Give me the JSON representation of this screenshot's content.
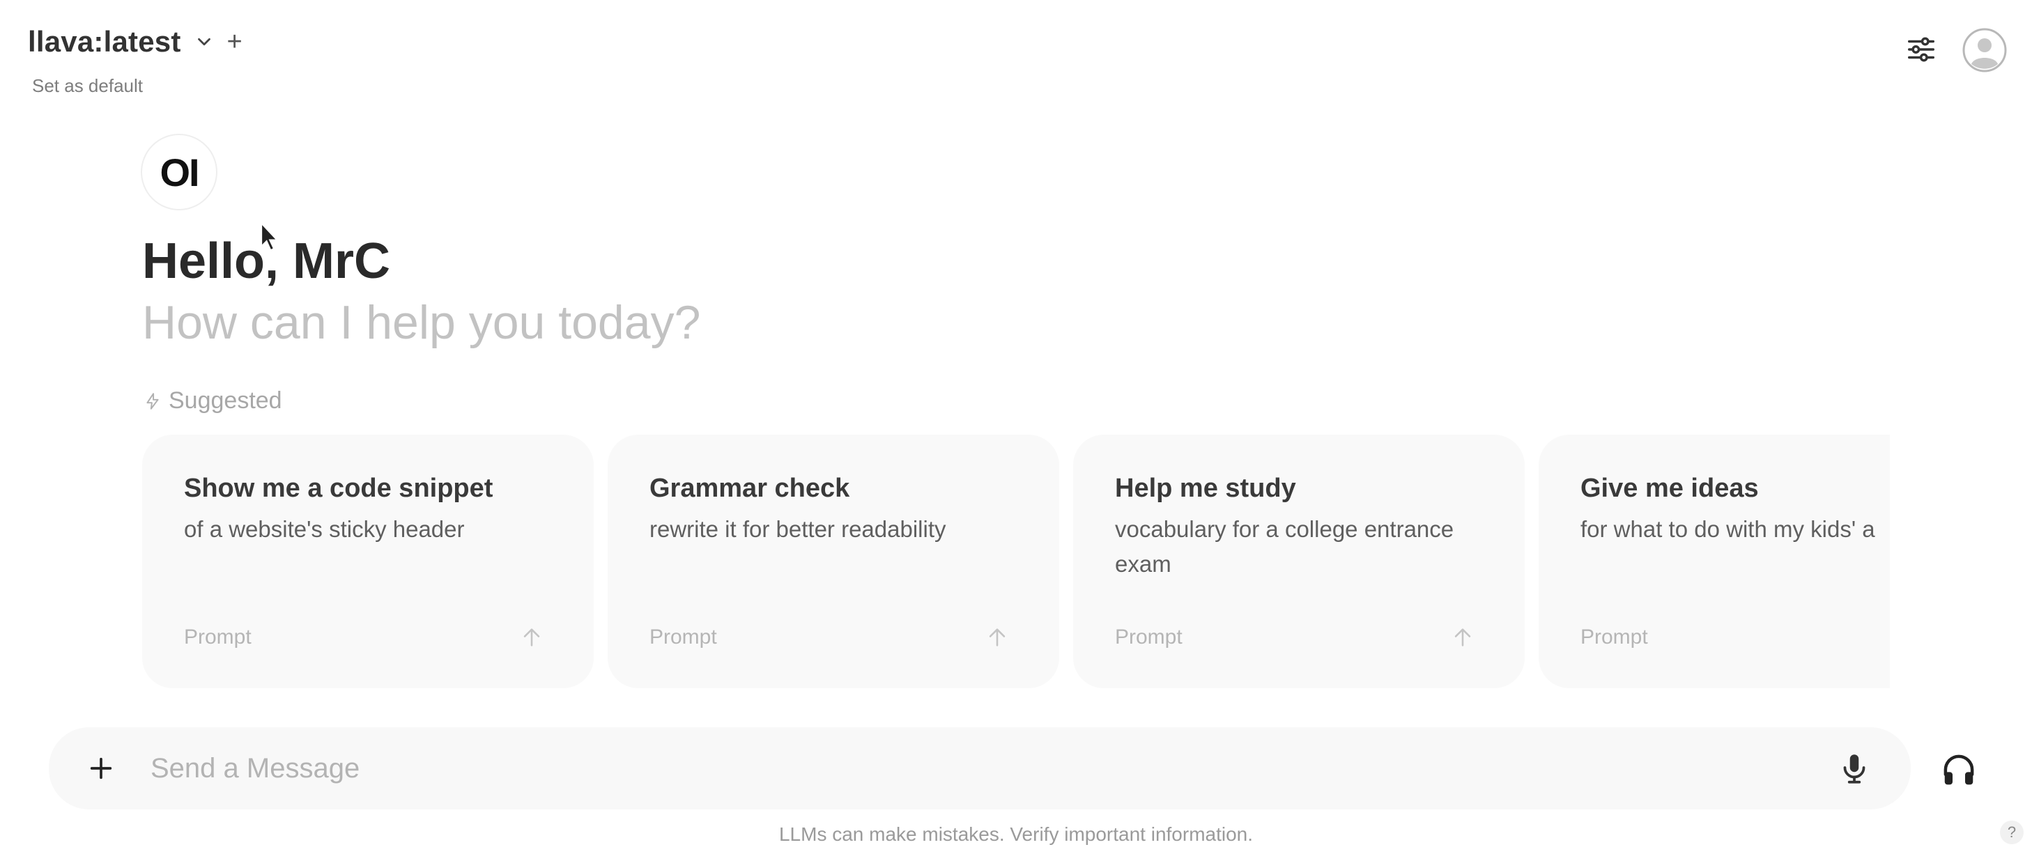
{
  "header": {
    "model_name": "llava:latest",
    "add_model_symbol": "+",
    "set_default_label": "Set as default",
    "controls_icon": "sliders-icon",
    "avatar_icon": "user-avatar-icon"
  },
  "greeting": {
    "logo_text": "OI",
    "hello": "Hello, MrC",
    "subtitle": "How can I help you today?"
  },
  "suggested": {
    "label": "Suggested",
    "icon": "bolt-icon",
    "cards": [
      {
        "title": "Show me a code snippet",
        "description": "of a website's sticky header",
        "footer": "Prompt"
      },
      {
        "title": "Grammar check",
        "description": "rewrite it for better readability",
        "footer": "Prompt"
      },
      {
        "title": "Help me study",
        "description": "vocabulary for a college entrance exam",
        "footer": "Prompt"
      },
      {
        "title": "Give me ideas",
        "description": "for what to do with my kids' a",
        "footer": "Prompt"
      }
    ]
  },
  "composer": {
    "placeholder": "Send a Message",
    "plus_icon": "plus-icon",
    "mic_icon": "microphone-icon",
    "voice_icon": "headphones-icon"
  },
  "footer": {
    "disclaimer": "LLMs can make mistakes. Verify important information.",
    "help_symbol": "?"
  },
  "colors": {
    "background": "#ffffff",
    "card_background": "#f9f9f9",
    "input_background": "#f8f8f8",
    "subtitle_gray": "#c2c2c2",
    "text_dark": "#2a2a2a"
  }
}
